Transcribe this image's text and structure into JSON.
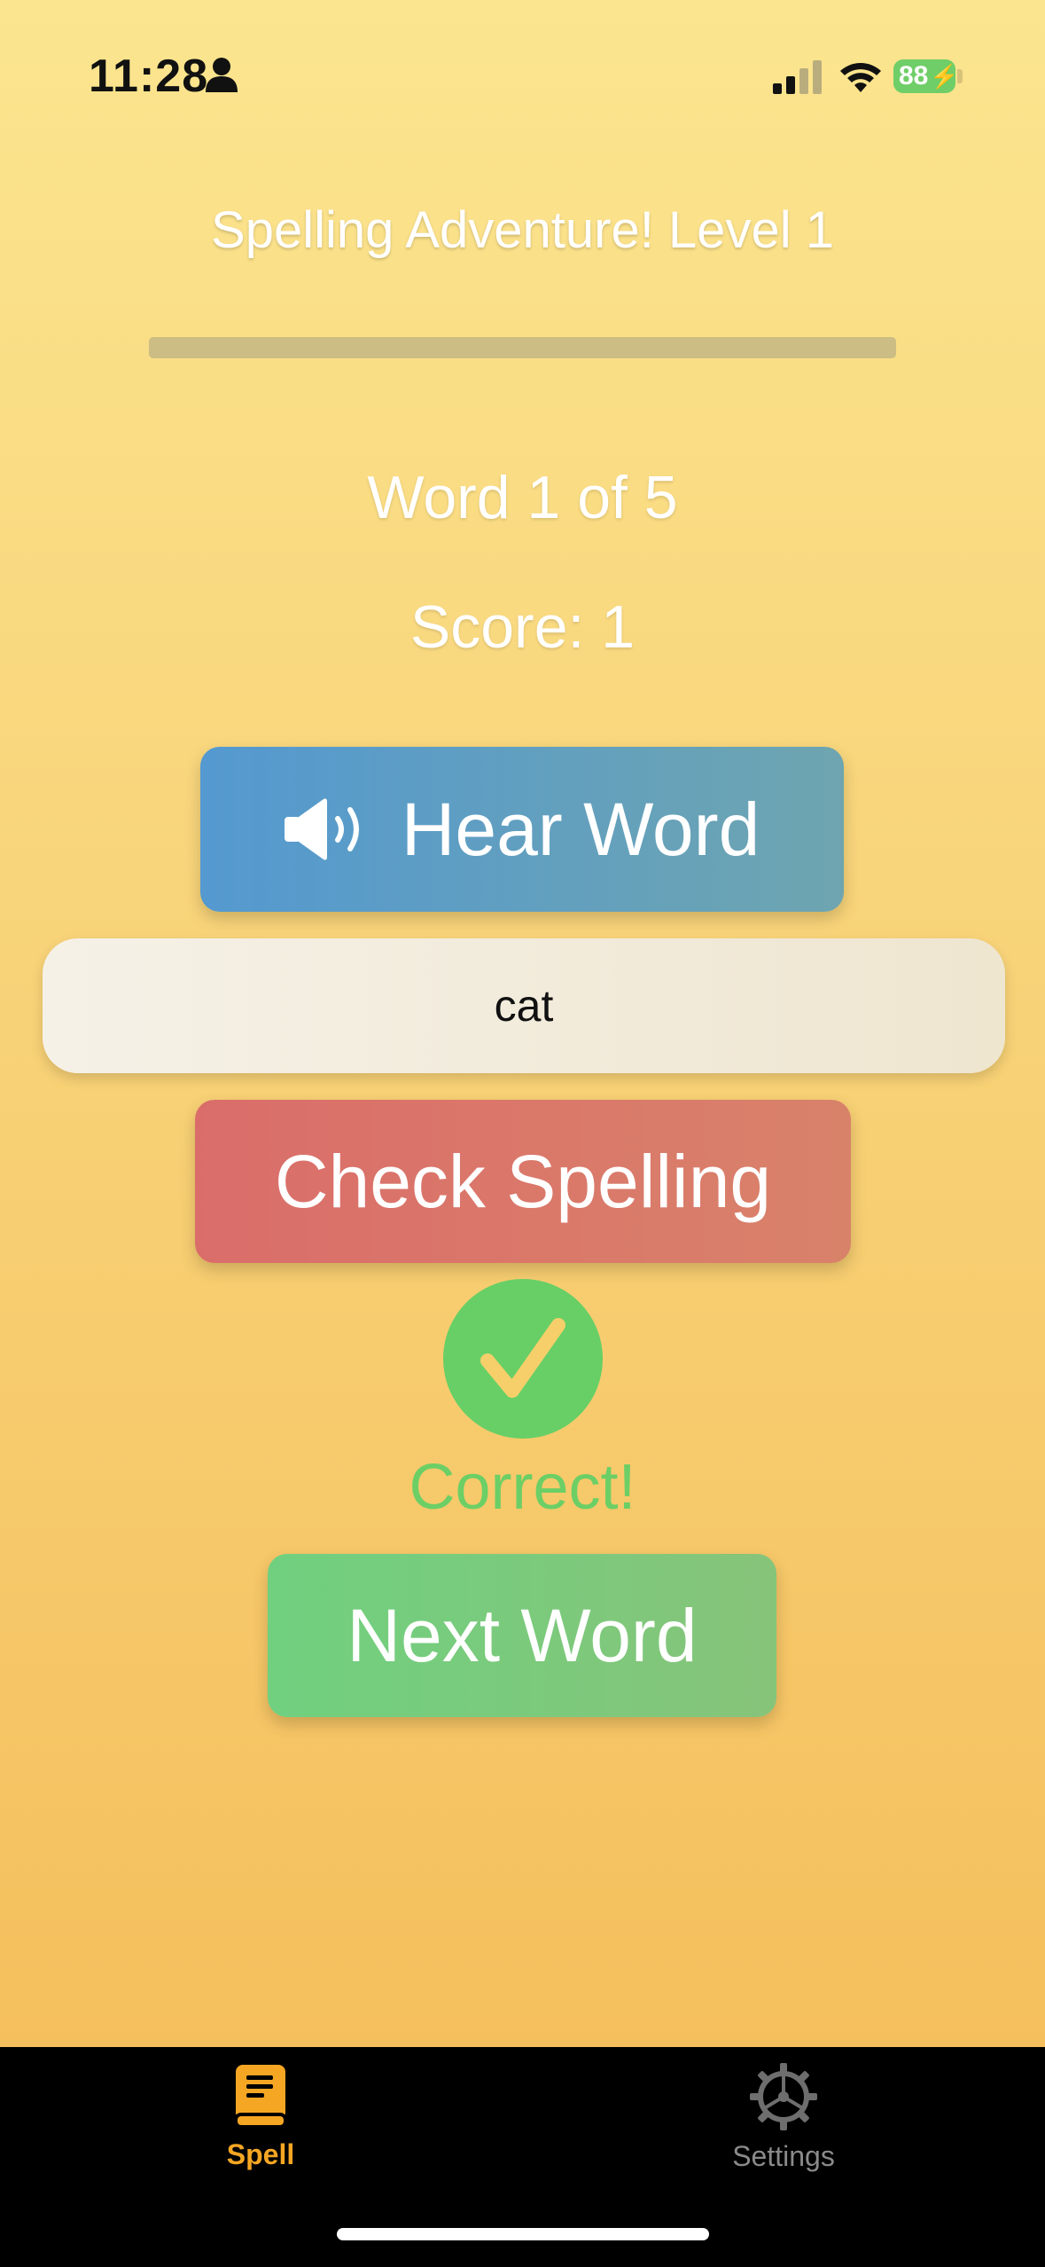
{
  "status_bar": {
    "time": "11:28",
    "battery": "88",
    "icons": [
      "person-icon",
      "signal-icon",
      "wifi-icon",
      "battery-icon"
    ]
  },
  "header": {
    "title": "Spelling Adventure! Level 1",
    "progress_fraction": 0.0
  },
  "quiz": {
    "word_counter": "Word 1 of 5",
    "score": "Score: 1",
    "hear_label": "Hear Word",
    "answer_value": "cat",
    "check_label": "Check Spelling",
    "feedback": "Correct!",
    "next_label": "Next Word"
  },
  "tabs": [
    {
      "label": "Spell",
      "icon": "book-icon",
      "active": true
    },
    {
      "label": "Settings",
      "icon": "gear-icon",
      "active": false
    }
  ],
  "colors": {
    "accent_orange": "#f5a623",
    "hear_blue": "#5499d0",
    "check_red": "#da6d6a",
    "next_green": "#70d07f",
    "correct_green": "#6ccf66"
  }
}
